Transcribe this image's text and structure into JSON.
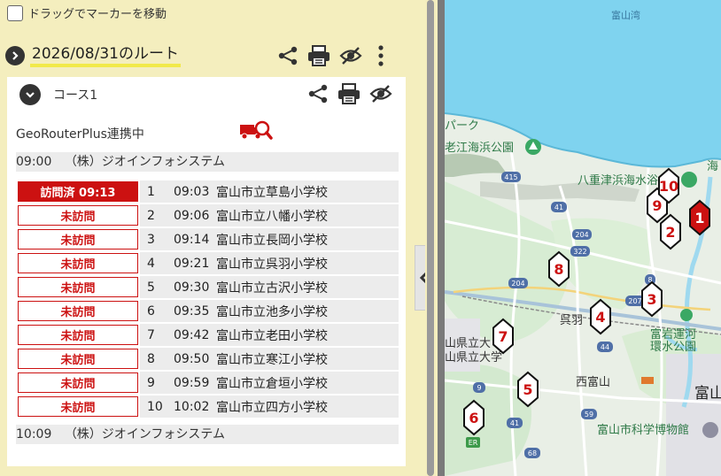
{
  "drag_label": "ドラッグでマーカーを移動",
  "route": {
    "title": "2026/08/31のルート"
  },
  "course": {
    "name": "コース1",
    "geo_label": "GeoRouterPlus連携中",
    "start": {
      "time": "09:00",
      "name": "（株）ジオインフォシステム"
    },
    "end": {
      "time": "10:09",
      "name": "（株）ジオインフォシステム"
    },
    "stops": [
      {
        "status": "訪問済 09:13",
        "done": true,
        "num": "1",
        "time": "09:03",
        "name": "富山市立草島小学校"
      },
      {
        "status": "未訪問",
        "done": false,
        "num": "2",
        "time": "09:06",
        "name": "富山市立八幡小学校"
      },
      {
        "status": "未訪問",
        "done": false,
        "num": "3",
        "time": "09:14",
        "name": "富山市立長岡小学校"
      },
      {
        "status": "未訪問",
        "done": false,
        "num": "4",
        "time": "09:21",
        "name": "富山市立呉羽小学校"
      },
      {
        "status": "未訪問",
        "done": false,
        "num": "5",
        "time": "09:30",
        "name": "富山市立古沢小学校"
      },
      {
        "status": "未訪問",
        "done": false,
        "num": "6",
        "time": "09:35",
        "name": "富山市立池多小学校"
      },
      {
        "status": "未訪問",
        "done": false,
        "num": "7",
        "time": "09:42",
        "name": "富山市立老田小学校"
      },
      {
        "status": "未訪問",
        "done": false,
        "num": "8",
        "time": "09:50",
        "name": "富山市立寒江小学校"
      },
      {
        "status": "未訪問",
        "done": false,
        "num": "9",
        "time": "09:59",
        "name": "富山市立倉垣小学校"
      },
      {
        "status": "未訪問",
        "done": false,
        "num": "10",
        "time": "10:02",
        "name": "富山市立四方小学校"
      }
    ]
  },
  "map": {
    "labels": {
      "bay": "富山湾",
      "park": "パーク",
      "beach_park": "老江海浜公園",
      "yae": "八重津浜海水浴",
      "kureha": "呉羽",
      "canal_1": "富岩運河",
      "canal_2": "環水公園",
      "toyama_pref_1": "山県立大",
      "toyama_pref_2": "山県立大学",
      "nishi_toyama": "西富山",
      "museum": "富山市科学博物館",
      "toyama": "富山",
      "sea_edge": "海"
    },
    "routes": [
      "415",
      "41",
      "204",
      "322",
      "204",
      "8",
      "207",
      "44",
      "9",
      "41",
      "59",
      "68",
      "ER"
    ],
    "markers": [
      "1",
      "2",
      "3",
      "4",
      "5",
      "6",
      "7",
      "8",
      "9",
      "10"
    ]
  },
  "colors": {
    "accent": "#cc1111",
    "sea": "#7fd3ef",
    "highlight": "#f1e94a",
    "panel": "#f4eebe"
  }
}
